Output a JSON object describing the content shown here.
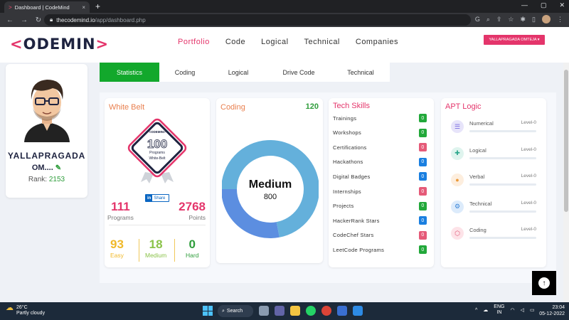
{
  "browser": {
    "tab_title": "Dashboard | CodeMind",
    "tab_close": "×",
    "new_tab": "+",
    "url_domain": "thecodemind.io",
    "url_path": "/app/dashboard.php"
  },
  "header": {
    "logo_open": "<",
    "logo_text": "ODEMIN",
    "logo_close": ">",
    "nav": [
      "Portfolio",
      "Code",
      "Logical",
      "Technical",
      "Companies"
    ],
    "user_button": "YALLAPRAGADA OMTEJA ▾"
  },
  "profile": {
    "name_line1": "YALLAPRAGADA",
    "name_line2": "OM....",
    "rank_label": "Rank:",
    "rank_value": "2153"
  },
  "subtabs": [
    "Statistics",
    "Coding",
    "Logical",
    "Drive Code",
    "Technical"
  ],
  "white_belt": {
    "title": "White Belt",
    "badge_logo": "<ODEMIN>",
    "badge_number": "100",
    "badge_line1": "Programs",
    "badge_line2": "White-Belt",
    "share_in": "in",
    "share_label": "Share",
    "programs_value": "111",
    "programs_label": "Programs",
    "points_value": "2768",
    "points_label": "Points",
    "easy_value": "93",
    "easy_label": "Easy",
    "medium_value": "18",
    "medium_label": "Medium",
    "hard_value": "0",
    "hard_label": "Hard"
  },
  "coding": {
    "title": "Coding",
    "count": "120",
    "center_label": "Medium",
    "center_value": "800",
    "ring_light_fraction": 0.72,
    "ring_light_color": "#64b0db",
    "ring_dark_color": "#5c8ee0"
  },
  "tech_skills": {
    "title": "Tech Skills",
    "items": [
      {
        "label": "Trainings",
        "value": "0",
        "color": "#22a83a"
      },
      {
        "label": "Workshops",
        "value": "0",
        "color": "#22a83a"
      },
      {
        "label": "Certifications",
        "value": "0",
        "color": "#e55a78"
      },
      {
        "label": "Hackathons",
        "value": "0",
        "color": "#1a7fe0"
      },
      {
        "label": "Digital Badges",
        "value": "0",
        "color": "#1a7fe0"
      },
      {
        "label": "Internships",
        "value": "0",
        "color": "#e55a78"
      },
      {
        "label": "Projects",
        "value": "0",
        "color": "#22a83a"
      },
      {
        "label": "HackerRank Stars",
        "value": "0",
        "color": "#1a7fe0"
      },
      {
        "label": "CodeChef Stars",
        "value": "0",
        "color": "#e55a78"
      },
      {
        "label": "LeetCode Programs",
        "value": "0",
        "color": "#22a83a"
      }
    ]
  },
  "apt_logic": {
    "title": "APT Logic",
    "items": [
      {
        "label": "Numerical",
        "level": "Level-0",
        "icon": "list-icon",
        "glyph": "☰",
        "bg": "#e7e4fa",
        "fg": "#7a6be0"
      },
      {
        "label": "Logical",
        "level": "Level-0",
        "icon": "puzzle-icon",
        "glyph": "✚",
        "bg": "#dff4ee",
        "fg": "#2ba78c"
      },
      {
        "label": "Verbal",
        "level": "Level-0",
        "icon": "chat-icon",
        "glyph": "●",
        "bg": "#fdeede",
        "fg": "#eb9a3b"
      },
      {
        "label": "Technical",
        "level": "Level-0",
        "icon": "gears-icon",
        "glyph": "⚙",
        "bg": "#dcebfb",
        "fg": "#3b86d8"
      },
      {
        "label": "Coding",
        "level": "Level-0",
        "icon": "hexagon-icon",
        "glyph": "⬡",
        "bg": "#fde3e8",
        "fg": "#e05573"
      }
    ]
  },
  "taskbar": {
    "temperature": "26°C",
    "weather": "Partly cloudy",
    "search_label": "Search",
    "lang_line1": "ENG",
    "lang_line2": "IN",
    "time": "23:04",
    "date": "05-12-2022"
  }
}
